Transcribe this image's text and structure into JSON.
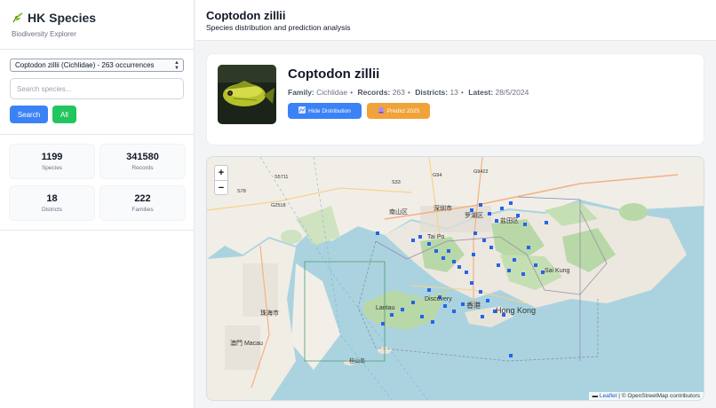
{
  "app": {
    "title": "HK Species",
    "subtitle": "Biodiversity Explorer"
  },
  "species_select": {
    "value": "Coptodon zillii (Cichlidae) - 263 occurrences"
  },
  "search": {
    "placeholder": "Search species...",
    "button": "Search",
    "all_button": "All"
  },
  "stats": [
    {
      "value": "1199",
      "label": "Species"
    },
    {
      "value": "341580",
      "label": "Records"
    },
    {
      "value": "18",
      "label": "Districts"
    },
    {
      "value": "222",
      "label": "Families"
    }
  ],
  "header": {
    "title": "Coptodon zillii",
    "subtitle": "Species distribution and prediction analysis"
  },
  "species": {
    "name": "Coptodon zillii",
    "family_label": "Family:",
    "family": "Cichlidae",
    "records_label": "Records:",
    "records": "263",
    "districts_label": "Districts:",
    "districts": "13",
    "latest_label": "Latest:",
    "latest": "28/5/2024",
    "hide_btn": "Hide Distribution",
    "predict_btn": "Predict 2025"
  },
  "map": {
    "zoom_in": "+",
    "zoom_out": "−",
    "leaflet": "Leaflet",
    "attribution": "| © OpenStreetMap contributors",
    "labels": [
      "深圳市",
      "罗湖区",
      "盐田区",
      "南山区",
      "珠海市",
      "澳門 Macau",
      "Hong Kong",
      "香港",
      "Discovery",
      "Tai Po",
      "Sai Kung",
      "Lantau",
      "S33",
      "G94",
      "G9422",
      "G2518",
      "S5711",
      "S78",
      "桂山岛"
    ],
    "marker_color": "#2563eb"
  },
  "icons": {
    "brand": "leaf-icon",
    "hide": "map-icon",
    "predict": "crystal-ball-icon"
  }
}
